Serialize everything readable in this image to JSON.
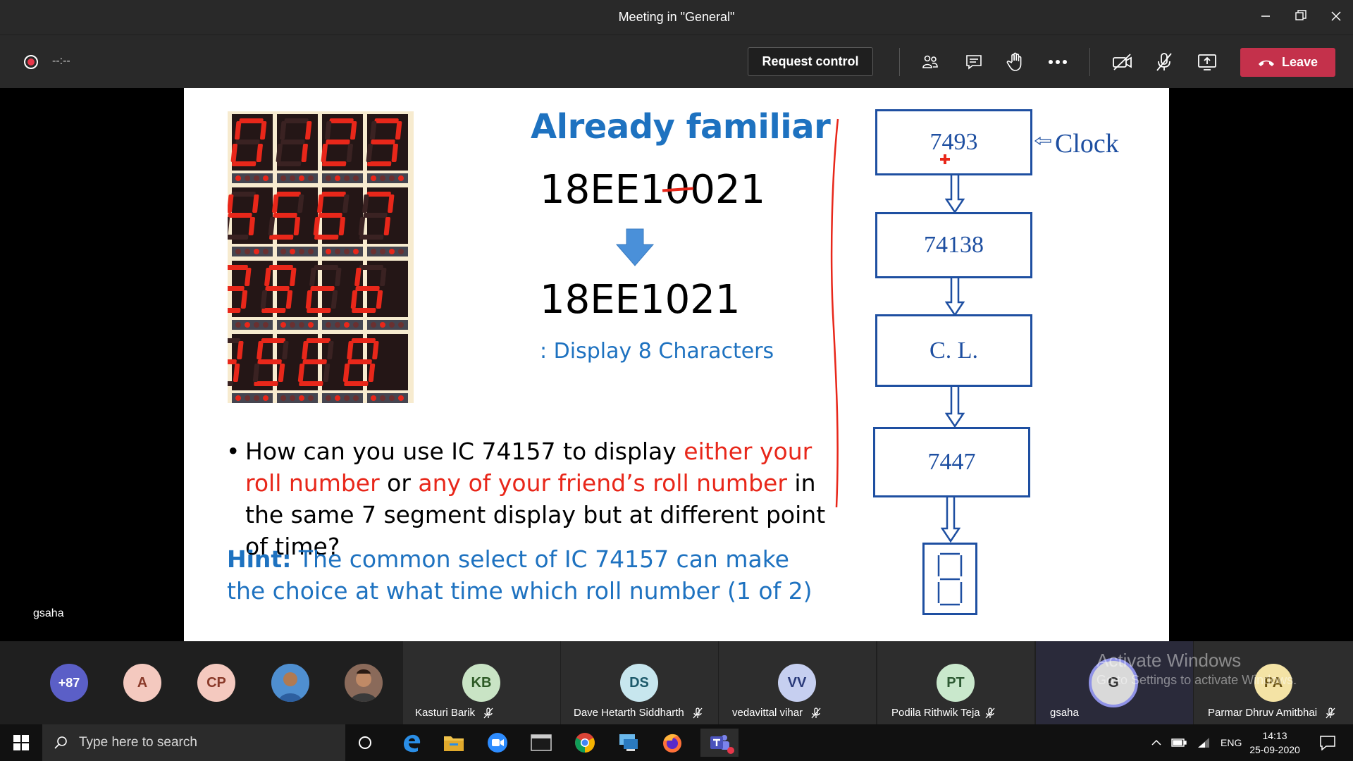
{
  "window": {
    "title": "Meeting in \"General\"",
    "minimize_icon": "minimize-icon",
    "restore_icon": "restore-icon",
    "close_icon": "close-icon"
  },
  "toolbar": {
    "timer": "--:--",
    "request_control_label": "Request control",
    "leave_label": "Leave",
    "icons": [
      "participants-icon",
      "chat-icon",
      "raise-hand-icon",
      "more-options-icon",
      "camera-off-icon",
      "mic-off-icon",
      "share-screen-icon"
    ],
    "accent": "#c4314b"
  },
  "presenter": {
    "name": "gsaha"
  },
  "slide": {
    "title": "Already familiar",
    "roll_before_prefix": "18EE1",
    "roll_before_struck": "0",
    "roll_before_suffix": "021",
    "roll_after": "18EE1021",
    "display_note": ": Display 8 Characters",
    "question": {
      "bullet": "•",
      "part1": "How can you use IC 74157 to display ",
      "red1": "either your roll number",
      "part2": " or ",
      "red2": "any of your friend’s roll number",
      "part3": " in the same 7 segment display but at different point of time?"
    },
    "hint": {
      "label": "Hint:",
      "text": " The common select of IC 74157 can make the choice at what time which roll number (1 of 2)"
    },
    "seven_segment_digits": [
      "0",
      "1",
      "2",
      "3",
      "4",
      "5",
      "6",
      "7",
      "8",
      "9",
      "c",
      "b",
      "4",
      "5",
      "E",
      "8"
    ],
    "flow": {
      "clock_label": "Clock",
      "blocks": [
        "7493",
        "74138",
        "C. L.",
        "7447"
      ],
      "display_glyph": "8"
    }
  },
  "participants": {
    "overflow_count": "+87",
    "avatars": [
      {
        "initials": "A",
        "bg": "#f4c9bf",
        "fg": "#8a3a2a"
      },
      {
        "initials": "CP",
        "bg": "#f4c9bf",
        "fg": "#8a3a2a"
      }
    ],
    "tiles": [
      {
        "initials": "KB",
        "name": "Kasturi Barik",
        "bg": "#c9e4c5",
        "fg": "#2d5a26"
      },
      {
        "initials": "DS",
        "name": "Dave Hetarth Siddharth",
        "bg": "#c7e6ee",
        "fg": "#1d5a6b"
      },
      {
        "initials": "VV",
        "name": "vedavittal vihar",
        "bg": "#c6cff0",
        "fg": "#2a3a7a"
      },
      {
        "initials": "PT",
        "name": "Podila Rithwik Teja",
        "bg": "#c9e8cc",
        "fg": "#2d5a33"
      },
      {
        "initials": "G",
        "name": "gsaha",
        "bg": "#d9d9d9",
        "fg": "#333333"
      },
      {
        "initials": "PA",
        "name": "Parmar Dhruv Amitbhai",
        "bg": "#f4e3a5",
        "fg": "#6a5210"
      }
    ]
  },
  "watermark": {
    "line1": "Activate Windows",
    "line2": "Go to Settings to activate Windows."
  },
  "taskbar": {
    "search_placeholder": "Type here to search",
    "language": "ENG",
    "time": "14:13",
    "date": "25-09-2020"
  }
}
